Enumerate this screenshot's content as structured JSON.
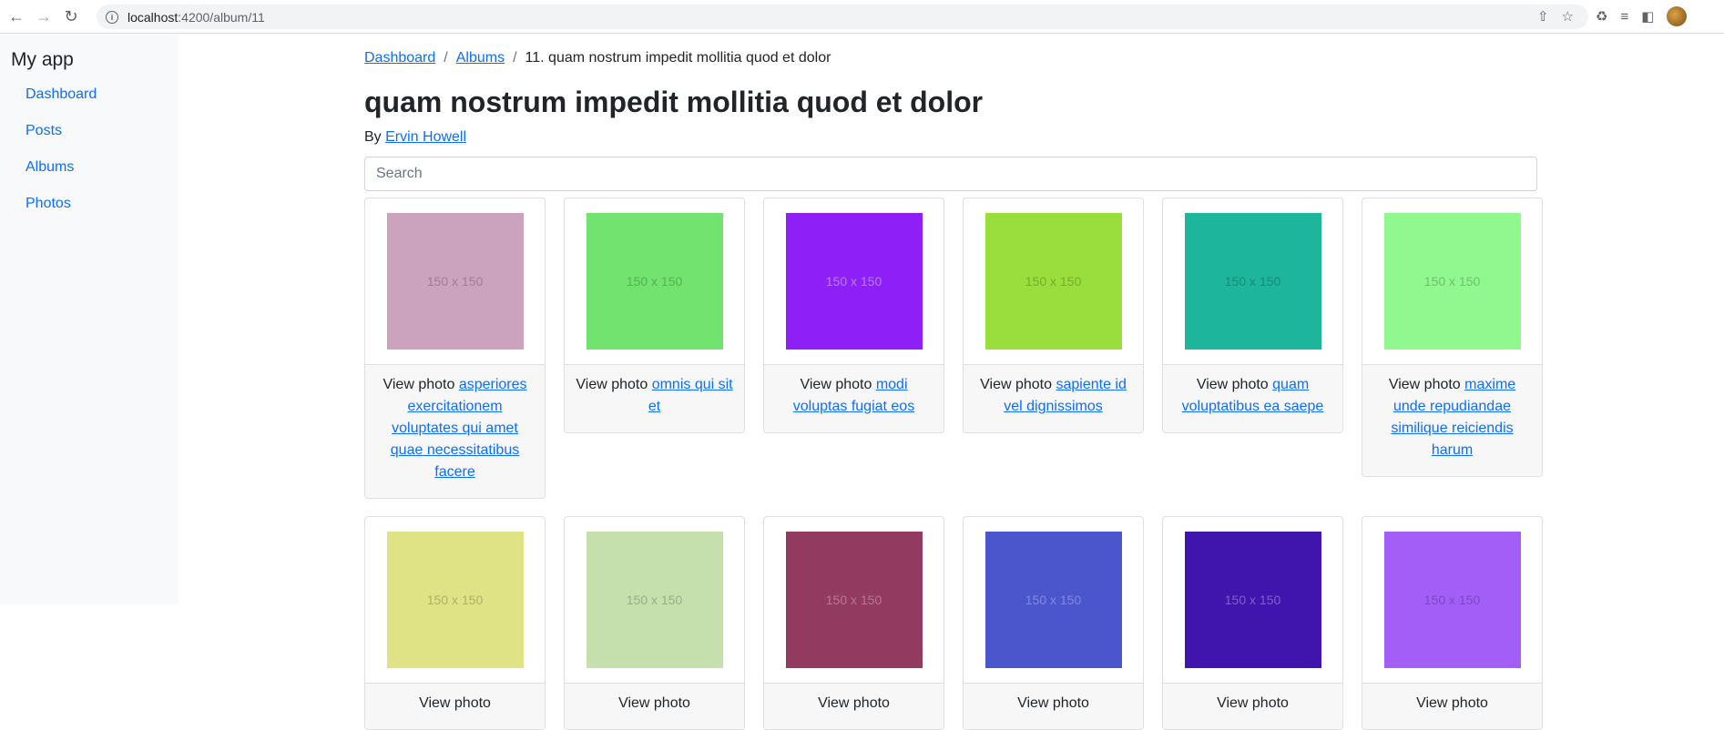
{
  "browser": {
    "url_host": "localhost",
    "url_path": ":4200/album/11"
  },
  "app": {
    "brand": "My app",
    "nav": [
      {
        "label": "Dashboard"
      },
      {
        "label": "Posts"
      },
      {
        "label": "Albums"
      },
      {
        "label": "Photos"
      }
    ]
  },
  "breadcrumb": {
    "items": [
      "Dashboard",
      "Albums"
    ],
    "separator": "/",
    "current": "11. quam nostrum impedit mollitia quod et dolor"
  },
  "album": {
    "title": "quam nostrum impedit mollitia quod et dolor",
    "by_prefix": "By",
    "author": "Ervin Howell"
  },
  "search": {
    "placeholder": "Search",
    "value": ""
  },
  "photos": [
    {
      "color": "#cca3be",
      "size_label": "150 x 150",
      "prefix": "View photo",
      "title": "asperiores exercitationem voluptates qui amet quae necessitatibus facere",
      "text_color": "#9e7f93"
    },
    {
      "color": "#72e36f",
      "size_label": "150 x 150",
      "prefix": "View photo",
      "title": "omnis qui sit et",
      "text_color": "#58b055"
    },
    {
      "color": "#8e20f7",
      "size_label": "150 x 150",
      "prefix": "View photo",
      "title": "modi voluptas fugiat eos",
      "text_color": "#b47ef9"
    },
    {
      "color": "#9ade3e",
      "size_label": "150 x 150",
      "prefix": "View photo",
      "title": "sapiente id vel dignissimos",
      "text_color": "#78ac30"
    },
    {
      "color": "#1db59b",
      "size_label": "150 x 150",
      "prefix": "View photo",
      "title": "quam voluptatibus ea saepe",
      "text_color": "#178d79"
    },
    {
      "color": "#90f88f",
      "size_label": "150 x 150",
      "prefix": "View photo",
      "title": "maxime unde repudiandae similique reiciendis harum",
      "text_color": "#70c16f"
    },
    {
      "color": "#e0e385",
      "size_label": "150 x 150",
      "prefix": "View photo",
      "title": "",
      "text_color": "#aeb067"
    },
    {
      "color": "#c5e0ad",
      "size_label": "150 x 150",
      "prefix": "View photo",
      "title": "",
      "text_color": "#99ae87"
    },
    {
      "color": "#933a60",
      "size_label": "150 x 150",
      "prefix": "View photo",
      "title": "",
      "text_color": "#b47895"
    },
    {
      "color": "#4c56cc",
      "size_label": "150 x 150",
      "prefix": "View photo",
      "title": "",
      "text_color": "#8289dd"
    },
    {
      "color": "#4015ad",
      "size_label": "150 x 150",
      "prefix": "View photo",
      "title": "",
      "text_color": "#7d61cc"
    },
    {
      "color": "#a25ef7",
      "size_label": "150 x 150",
      "prefix": "View photo",
      "title": "",
      "text_color": "#7d49c0"
    }
  ]
}
